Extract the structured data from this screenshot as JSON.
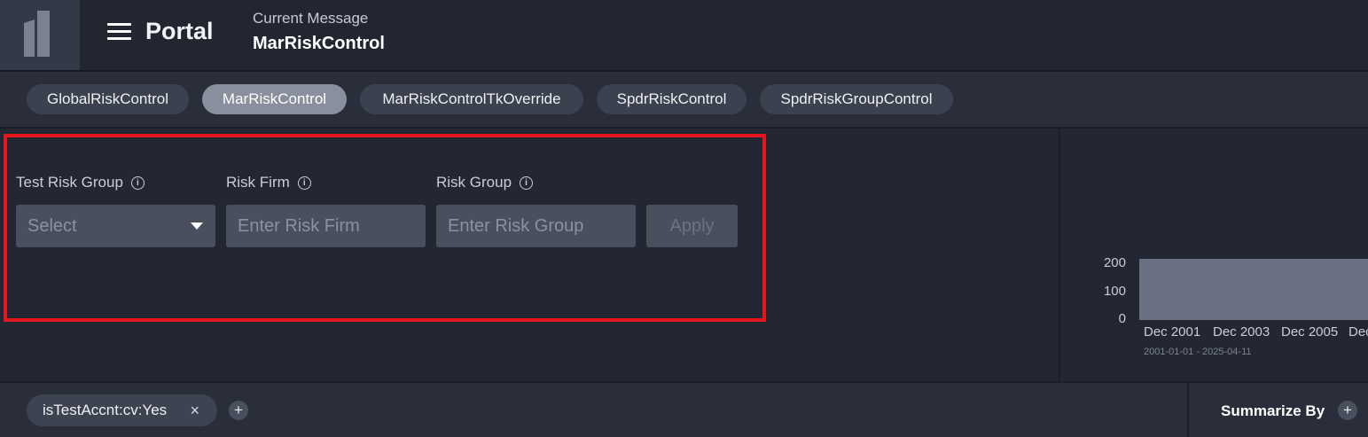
{
  "header": {
    "app_title": "Portal",
    "current_label": "Current Message",
    "current_value": "MarRiskControl",
    "logo_icon": "bars-logo-icon",
    "menu_icon": "hamburger-menu-icon"
  },
  "tabs": [
    {
      "label": "GlobalRiskControl",
      "active": false
    },
    {
      "label": "MarRiskControl",
      "active": true
    },
    {
      "label": "MarRiskControlTkOverride",
      "active": false
    },
    {
      "label": "SpdrRiskControl",
      "active": false
    },
    {
      "label": "SpdrRiskGroupControl",
      "active": false
    }
  ],
  "filters": {
    "test_risk_group": {
      "label": "Test Risk Group",
      "placeholder": "Select",
      "info_icon": "info-icon"
    },
    "risk_firm": {
      "label": "Risk Firm",
      "placeholder": "Enter Risk Firm",
      "info_icon": "info-icon"
    },
    "risk_group": {
      "label": "Risk Group",
      "placeholder": "Enter Risk Group",
      "info_icon": "info-icon"
    },
    "apply_label": "Apply"
  },
  "chart_data": {
    "type": "area",
    "y_ticks": [
      "200",
      "100",
      "0"
    ],
    "x_ticks": [
      "Dec 2001",
      "Dec 2003",
      "Dec 2005",
      "Dec"
    ],
    "range_label": "2001-01-01 - 2025-04-11",
    "ylim": [
      0,
      200
    ],
    "series": [
      {
        "values": [
          180,
          180,
          180,
          180
        ]
      }
    ],
    "fill_color": "#6b7082"
  },
  "bottom": {
    "chip_label": "isTestAccnt:cv:Yes",
    "chip_close": "×",
    "add_filter": "+",
    "summarize_label": "Summarize By",
    "summarize_add": "+"
  },
  "colors": {
    "accent_highlight": "#e3161b",
    "active_tab": "#8a8f9d",
    "background": "#232733"
  }
}
